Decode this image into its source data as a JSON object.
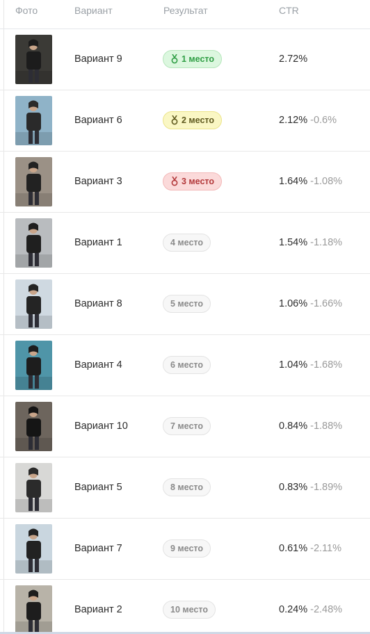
{
  "header": {
    "photo": "Фото",
    "variant": "Вариант",
    "result": "Результат",
    "ctr": "CTR"
  },
  "rows": [
    {
      "variant": "Вариант 9",
      "place": "1 место",
      "ctr": "2.72%",
      "delta": "",
      "badge": "gold",
      "medal": true,
      "photo_bg": "#3b3a36",
      "photo_fg": "#1c1c1c"
    },
    {
      "variant": "Вариант 6",
      "place": "2 место",
      "ctr": "2.12%",
      "delta": "-0.6%",
      "badge": "yellow",
      "medal": true,
      "photo_bg": "#8fb3c8",
      "photo_fg": "#2a2a2a"
    },
    {
      "variant": "Вариант 3",
      "place": "3 место",
      "ctr": "1.64%",
      "delta": "-1.08%",
      "badge": "red",
      "medal": true,
      "photo_bg": "#9b9186",
      "photo_fg": "#222222"
    },
    {
      "variant": "Вариант 1",
      "place": "4 место",
      "ctr": "1.54%",
      "delta": "-1.18%",
      "badge": "plain",
      "medal": false,
      "photo_bg": "#b9bcbf",
      "photo_fg": "#1f1f1f"
    },
    {
      "variant": "Вариант 8",
      "place": "5 место",
      "ctr": "1.06%",
      "delta": "-1.66%",
      "badge": "plain",
      "medal": false,
      "photo_bg": "#cfd9e1",
      "photo_fg": "#242424"
    },
    {
      "variant": "Вариант 4",
      "place": "6 место",
      "ctr": "1.04%",
      "delta": "-1.68%",
      "badge": "plain",
      "medal": false,
      "photo_bg": "#4f95a8",
      "photo_fg": "#1d1d1d"
    },
    {
      "variant": "Вариант 10",
      "place": "7 место",
      "ctr": "0.84%",
      "delta": "-1.88%",
      "badge": "plain",
      "medal": false,
      "photo_bg": "#6d655d",
      "photo_fg": "#151515"
    },
    {
      "variant": "Вариант 5",
      "place": "8 место",
      "ctr": "0.83%",
      "delta": "-1.89%",
      "badge": "plain",
      "medal": false,
      "photo_bg": "#d8d8d6",
      "photo_fg": "#2b2b2b"
    },
    {
      "variant": "Вариант 7",
      "place": "9 место",
      "ctr": "0.61%",
      "delta": "-2.11%",
      "badge": "plain",
      "medal": false,
      "photo_bg": "#c9d6df",
      "photo_fg": "#222222"
    },
    {
      "variant": "Вариант 2",
      "place": "10 место",
      "ctr": "0.24%",
      "delta": "-2.48%",
      "badge": "plain",
      "medal": false,
      "photo_bg": "#b8b3a8",
      "photo_fg": "#1d1d1d"
    }
  ]
}
